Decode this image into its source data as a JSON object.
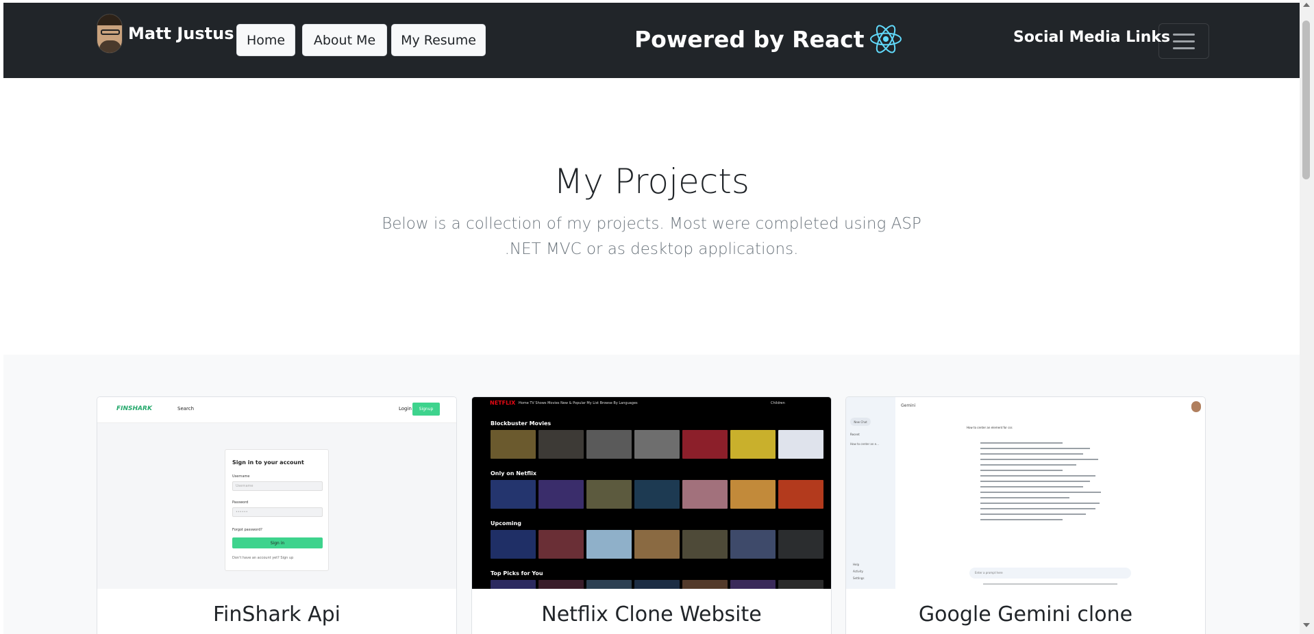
{
  "navbar": {
    "brand_name": "Matt Justus",
    "buttons": [
      "Home",
      "About Me",
      "My Resume"
    ],
    "powered_text": "Powered by React",
    "social_label": "Social Media Links",
    "react_color": "#61dafb"
  },
  "hero": {
    "title": "My Projects",
    "subtitle": "Below is a collection of my projects. Most were completed using ASP .NET MVC or as desktop applications."
  },
  "projects": [
    {
      "title": "FinShark Api",
      "preview": {
        "logo": "FINSHARK",
        "nav_search": "Search",
        "login": "Login",
        "signup": "Signup",
        "heading": "Sign in to your account",
        "username_label": "Username",
        "username_placeholder": "Username",
        "password_label": "Password",
        "password_placeholder": "••••••",
        "forgot": "Forgot password?",
        "submit": "Sign in",
        "footer": "Don't have an account yet? Sign up"
      }
    },
    {
      "title": "Netflix Clone Website",
      "preview": {
        "logo": "NETFLIX",
        "nav": "Home   TV Shows   Movies   New & Popular   My List   Browse By Languages",
        "right": "Children",
        "rows": [
          "Blockbuster Movies",
          "Only on Netflix",
          "Upcoming",
          "Top Picks for You"
        ]
      }
    },
    {
      "title": "Google Gemini clone",
      "preview": {
        "app_title": "Gemini",
        "new_chat": "New Chat",
        "recent": "Recent",
        "recent_item": "How to center an e...",
        "help": "Help",
        "activity": "Activity",
        "settings": "Settings",
        "question": "How to center an element for css",
        "input_placeholder": "Enter a prompt here"
      }
    }
  ],
  "colors": {
    "navbar_bg": "#212529",
    "projects_bg": "#f8f9fa",
    "finshark_green": "#3ed38d",
    "netflix_red": "#e50914"
  }
}
